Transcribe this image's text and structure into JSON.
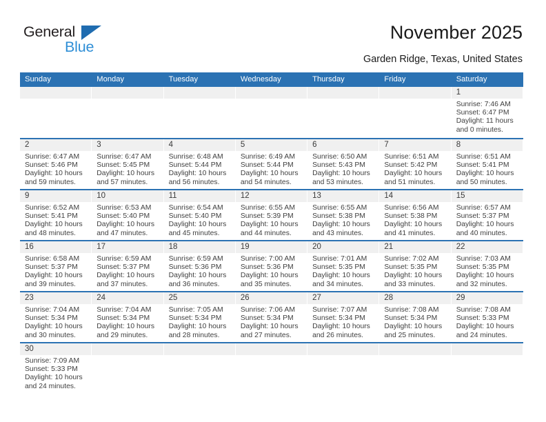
{
  "brand": {
    "name_top": "General",
    "name_bottom": "Blue",
    "triangle_icon": "blue-triangle-icon",
    "color_dark": "#231f20",
    "color_blue": "#2e8ed6",
    "color_triangle": "#1f6cb0"
  },
  "header": {
    "title": "November 2025",
    "subtitle": "Garden Ridge, Texas, United States"
  },
  "theme": {
    "header_bg": "#2b72b3",
    "header_text": "#ffffff",
    "daynum_bg": "#f0f0f0",
    "cell_bg": "#ffffff",
    "row_divider": "#2b72b3",
    "body_text": "#404040"
  },
  "weekday_headers": [
    "Sunday",
    "Monday",
    "Tuesday",
    "Wednesday",
    "Thursday",
    "Friday",
    "Saturday"
  ],
  "labels": {
    "sunrise_prefix": "Sunrise:",
    "sunset_prefix": "Sunset:",
    "daylight_prefix": "Daylight:"
  },
  "weeks": [
    [
      {
        "day": "",
        "lines": []
      },
      {
        "day": "",
        "lines": []
      },
      {
        "day": "",
        "lines": []
      },
      {
        "day": "",
        "lines": []
      },
      {
        "day": "",
        "lines": []
      },
      {
        "day": "",
        "lines": []
      },
      {
        "day": "1",
        "lines": [
          "Sunrise: 7:46 AM",
          "Sunset: 6:47 PM",
          "Daylight: 11 hours",
          "and 0 minutes."
        ]
      }
    ],
    [
      {
        "day": "2",
        "lines": [
          "Sunrise: 6:47 AM",
          "Sunset: 5:46 PM",
          "Daylight: 10 hours",
          "and 59 minutes."
        ]
      },
      {
        "day": "3",
        "lines": [
          "Sunrise: 6:47 AM",
          "Sunset: 5:45 PM",
          "Daylight: 10 hours",
          "and 57 minutes."
        ]
      },
      {
        "day": "4",
        "lines": [
          "Sunrise: 6:48 AM",
          "Sunset: 5:44 PM",
          "Daylight: 10 hours",
          "and 56 minutes."
        ]
      },
      {
        "day": "5",
        "lines": [
          "Sunrise: 6:49 AM",
          "Sunset: 5:44 PM",
          "Daylight: 10 hours",
          "and 54 minutes."
        ]
      },
      {
        "day": "6",
        "lines": [
          "Sunrise: 6:50 AM",
          "Sunset: 5:43 PM",
          "Daylight: 10 hours",
          "and 53 minutes."
        ]
      },
      {
        "day": "7",
        "lines": [
          "Sunrise: 6:51 AM",
          "Sunset: 5:42 PM",
          "Daylight: 10 hours",
          "and 51 minutes."
        ]
      },
      {
        "day": "8",
        "lines": [
          "Sunrise: 6:51 AM",
          "Sunset: 5:41 PM",
          "Daylight: 10 hours",
          "and 50 minutes."
        ]
      }
    ],
    [
      {
        "day": "9",
        "lines": [
          "Sunrise: 6:52 AM",
          "Sunset: 5:41 PM",
          "Daylight: 10 hours",
          "and 48 minutes."
        ]
      },
      {
        "day": "10",
        "lines": [
          "Sunrise: 6:53 AM",
          "Sunset: 5:40 PM",
          "Daylight: 10 hours",
          "and 47 minutes."
        ]
      },
      {
        "day": "11",
        "lines": [
          "Sunrise: 6:54 AM",
          "Sunset: 5:40 PM",
          "Daylight: 10 hours",
          "and 45 minutes."
        ]
      },
      {
        "day": "12",
        "lines": [
          "Sunrise: 6:55 AM",
          "Sunset: 5:39 PM",
          "Daylight: 10 hours",
          "and 44 minutes."
        ]
      },
      {
        "day": "13",
        "lines": [
          "Sunrise: 6:55 AM",
          "Sunset: 5:38 PM",
          "Daylight: 10 hours",
          "and 43 minutes."
        ]
      },
      {
        "day": "14",
        "lines": [
          "Sunrise: 6:56 AM",
          "Sunset: 5:38 PM",
          "Daylight: 10 hours",
          "and 41 minutes."
        ]
      },
      {
        "day": "15",
        "lines": [
          "Sunrise: 6:57 AM",
          "Sunset: 5:37 PM",
          "Daylight: 10 hours",
          "and 40 minutes."
        ]
      }
    ],
    [
      {
        "day": "16",
        "lines": [
          "Sunrise: 6:58 AM",
          "Sunset: 5:37 PM",
          "Daylight: 10 hours",
          "and 39 minutes."
        ]
      },
      {
        "day": "17",
        "lines": [
          "Sunrise: 6:59 AM",
          "Sunset: 5:37 PM",
          "Daylight: 10 hours",
          "and 37 minutes."
        ]
      },
      {
        "day": "18",
        "lines": [
          "Sunrise: 6:59 AM",
          "Sunset: 5:36 PM",
          "Daylight: 10 hours",
          "and 36 minutes."
        ]
      },
      {
        "day": "19",
        "lines": [
          "Sunrise: 7:00 AM",
          "Sunset: 5:36 PM",
          "Daylight: 10 hours",
          "and 35 minutes."
        ]
      },
      {
        "day": "20",
        "lines": [
          "Sunrise: 7:01 AM",
          "Sunset: 5:35 PM",
          "Daylight: 10 hours",
          "and 34 minutes."
        ]
      },
      {
        "day": "21",
        "lines": [
          "Sunrise: 7:02 AM",
          "Sunset: 5:35 PM",
          "Daylight: 10 hours",
          "and 33 minutes."
        ]
      },
      {
        "day": "22",
        "lines": [
          "Sunrise: 7:03 AM",
          "Sunset: 5:35 PM",
          "Daylight: 10 hours",
          "and 32 minutes."
        ]
      }
    ],
    [
      {
        "day": "23",
        "lines": [
          "Sunrise: 7:04 AM",
          "Sunset: 5:34 PM",
          "Daylight: 10 hours",
          "and 30 minutes."
        ]
      },
      {
        "day": "24",
        "lines": [
          "Sunrise: 7:04 AM",
          "Sunset: 5:34 PM",
          "Daylight: 10 hours",
          "and 29 minutes."
        ]
      },
      {
        "day": "25",
        "lines": [
          "Sunrise: 7:05 AM",
          "Sunset: 5:34 PM",
          "Daylight: 10 hours",
          "and 28 minutes."
        ]
      },
      {
        "day": "26",
        "lines": [
          "Sunrise: 7:06 AM",
          "Sunset: 5:34 PM",
          "Daylight: 10 hours",
          "and 27 minutes."
        ]
      },
      {
        "day": "27",
        "lines": [
          "Sunrise: 7:07 AM",
          "Sunset: 5:34 PM",
          "Daylight: 10 hours",
          "and 26 minutes."
        ]
      },
      {
        "day": "28",
        "lines": [
          "Sunrise: 7:08 AM",
          "Sunset: 5:34 PM",
          "Daylight: 10 hours",
          "and 25 minutes."
        ]
      },
      {
        "day": "29",
        "lines": [
          "Sunrise: 7:08 AM",
          "Sunset: 5:33 PM",
          "Daylight: 10 hours",
          "and 24 minutes."
        ]
      }
    ],
    [
      {
        "day": "30",
        "lines": [
          "Sunrise: 7:09 AM",
          "Sunset: 5:33 PM",
          "Daylight: 10 hours",
          "and 24 minutes."
        ]
      },
      {
        "day": "",
        "lines": []
      },
      {
        "day": "",
        "lines": []
      },
      {
        "day": "",
        "lines": []
      },
      {
        "day": "",
        "lines": []
      },
      {
        "day": "",
        "lines": []
      },
      {
        "day": "",
        "lines": []
      }
    ]
  ]
}
